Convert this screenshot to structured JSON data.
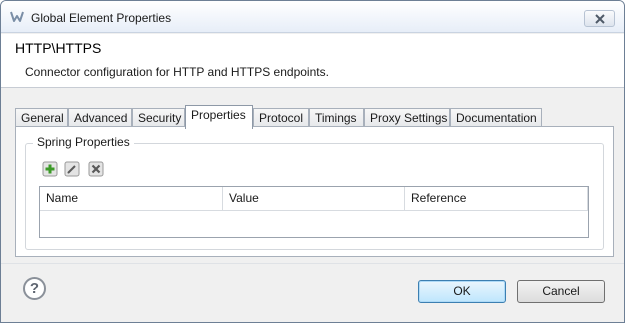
{
  "window": {
    "title": "Global Element Properties",
    "close_icon": "close-icon"
  },
  "header": {
    "title": "HTTP\\HTTPS",
    "description": "Connector configuration for HTTP and HTTPS endpoints."
  },
  "tabs": [
    {
      "label": "General"
    },
    {
      "label": "Advanced"
    },
    {
      "label": "Security"
    },
    {
      "label": "Properties",
      "active": true
    },
    {
      "label": "Protocol"
    },
    {
      "label": "Timings"
    },
    {
      "label": "Proxy Settings"
    },
    {
      "label": "Documentation"
    }
  ],
  "spring_properties": {
    "group_label": "Spring Properties",
    "toolbar": [
      {
        "icon": "add-icon",
        "color": "#3c9a28"
      },
      {
        "icon": "edit-icon",
        "color": "#5a5a5a"
      },
      {
        "icon": "delete-icon",
        "color": "#5a5a5a"
      }
    ],
    "columns": [
      "Name",
      "Value",
      "Reference"
    ],
    "rows": []
  },
  "footer": {
    "help_icon": "help-icon",
    "ok_label": "OK",
    "cancel_label": "Cancel"
  }
}
